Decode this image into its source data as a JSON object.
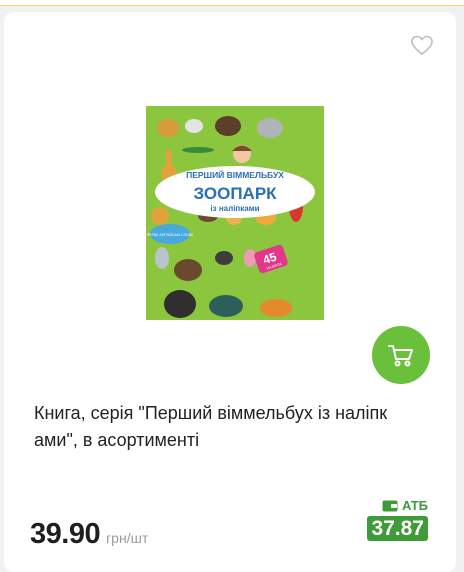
{
  "product": {
    "title": "Книга, серія \"Перший віммельбух із наліпк ами\", в асортименті",
    "price": "39.90",
    "unit": "грн/шт",
    "loyalty_label": "АТБ",
    "loyalty_price": "37.87"
  },
  "book_cover": {
    "line1": "ПЕРШИЙ ВІММЕЛЬБУХ",
    "line2": "ЗООПАРК",
    "line3": "із наліпками",
    "badge": "45",
    "badge_small": "НАЛІПОК",
    "note": "ПЕРШІ АНГЛІЙСЬКІ СЛОВА"
  },
  "colors": {
    "cover_green": "#8cc63e",
    "cart_button": "#6abf3b",
    "loyalty": "#3f9b3a"
  },
  "icons": {
    "favorite": "heart-outline-icon",
    "cart": "cart-icon",
    "loyalty": "wallet-icon"
  }
}
